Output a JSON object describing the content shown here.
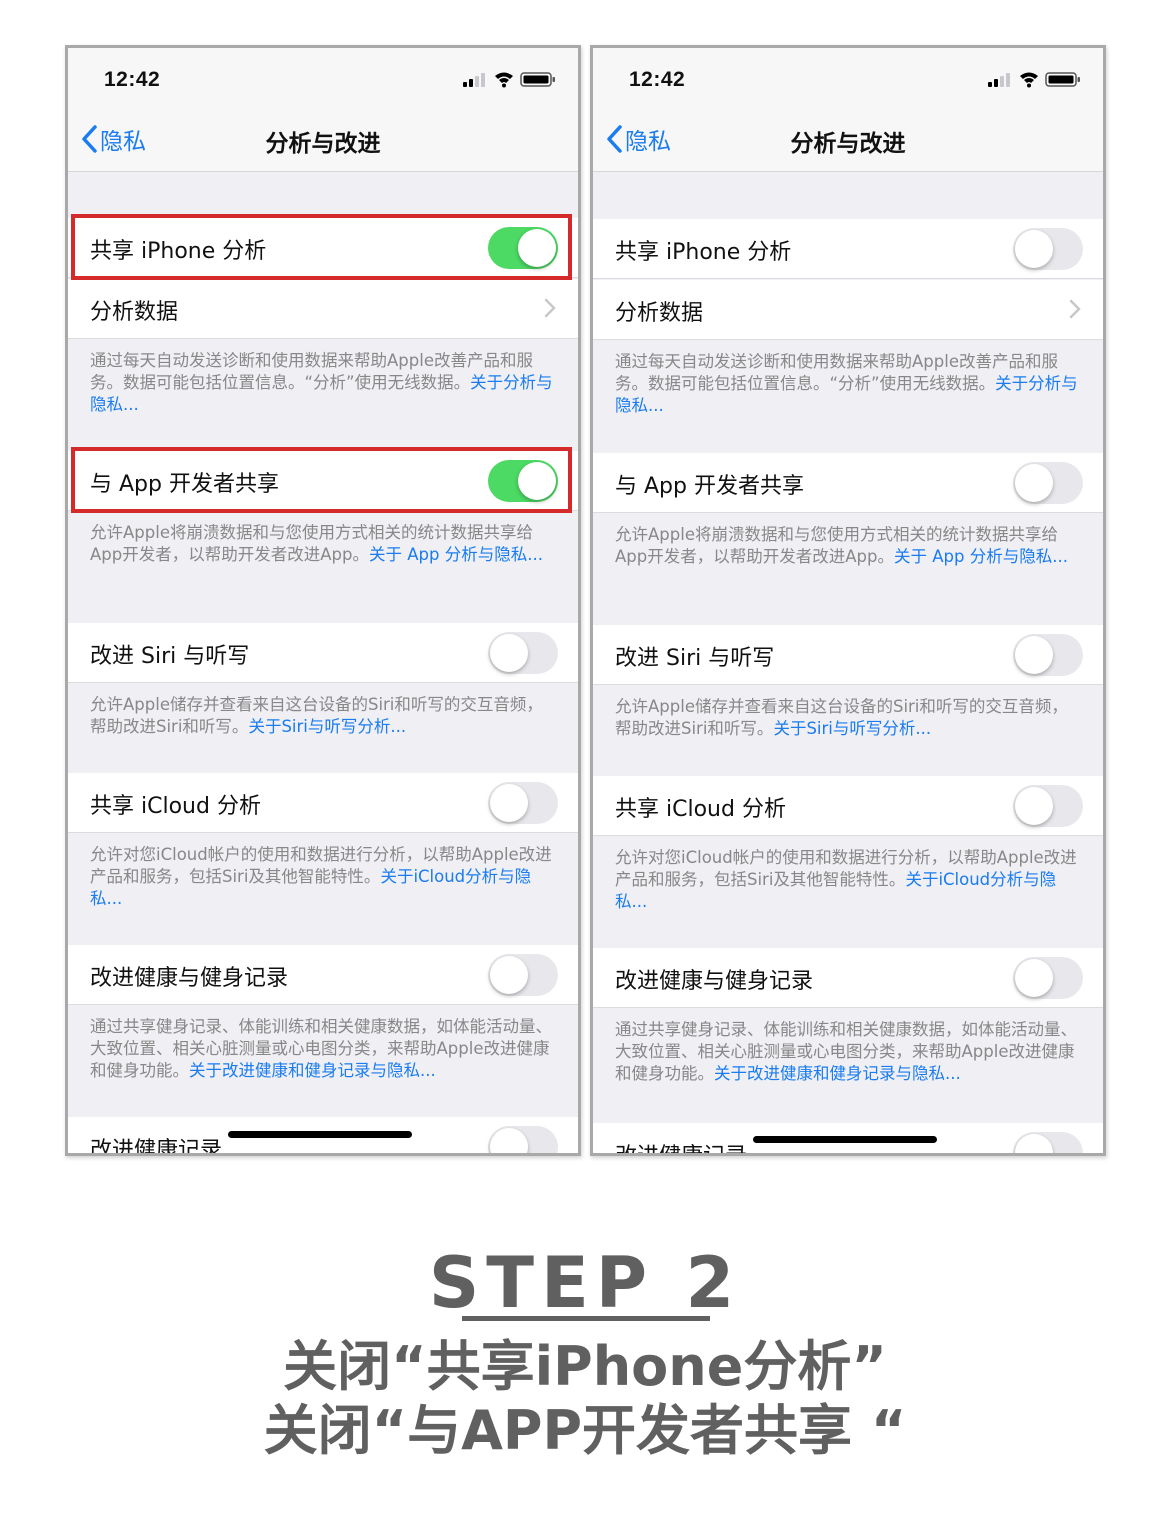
{
  "status_bar": {
    "time": "12:42"
  },
  "nav": {
    "back_label": "隐私",
    "title": "分析与改进"
  },
  "rows": {
    "share_iphone": "共享 iPhone 分析",
    "analytics_data": "分析数据",
    "share_dev": "与 App 开发者共享",
    "siri": "改进 Siri 与听写",
    "icloud": "共享 iCloud 分析",
    "health": "改进健康与健身记录",
    "health_records": "改进健康记录"
  },
  "footers": {
    "iphone": {
      "text": "通过每天自动发送诊断和使用数据来帮助Apple改善产品和服务。数据可能包括位置信息。“分析”使用无线数据。",
      "link": "关于分析与隐私..."
    },
    "dev": {
      "text": "允许Apple将崩溃数据和与您使用方式相关的统计数据共享给App开发者，以帮助开发者改进App。",
      "link": "关于 App 分析与隐私..."
    },
    "siri": {
      "text": "允许Apple储存并查看来自这台设备的Siri和听写的交互音频，帮助改进Siri和听写。",
      "link": "关于Siri与听写分析..."
    },
    "icloud": {
      "text": "允许对您iCloud帐户的使用和数据进行分析，以帮助Apple改进产品和服务，包括Siri及其他智能特性。",
      "link": "关于iCloud分析与隐私..."
    },
    "health": {
      "text": "通过共享健身记录、体能训练和相关健康数据，如体能活动量、大致位置、相关心脏测量或心电图分类，来帮助Apple改进健康和健身功能。",
      "link": "关于改进健康和健身记录与隐私..."
    }
  },
  "states": {
    "before": {
      "share_iphone": true,
      "share_dev": true,
      "siri": false,
      "icloud": false,
      "health": false,
      "health_records": false
    },
    "after": {
      "share_iphone": false,
      "share_dev": false,
      "siri": false,
      "icloud": false,
      "health": false,
      "health_records": false
    }
  },
  "step": {
    "title": "STEP 2",
    "line1": "关闭“共享iPhone分析”",
    "line2": "关闭“与APP开发者共享 “"
  },
  "colors": {
    "accent": "#1a7cf0",
    "toggle_on": "#4cd964",
    "highlight": "#d52a2a",
    "caption": "#606060"
  }
}
